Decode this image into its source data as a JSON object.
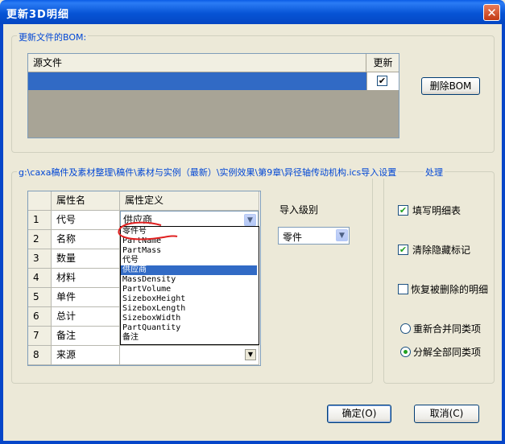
{
  "window": {
    "title": "更新3D明细",
    "close_glyph": "✕"
  },
  "bom_group": {
    "label": "更新文件的BOM:",
    "col_source": "源文件",
    "col_update": "更新",
    "row_checked": true,
    "delete_button": "删除BOM"
  },
  "settings_group": {
    "label": "g:\\caxa稿件及素材整理\\稿件\\素材与实例（最新）\\实例效果\\第9章\\异径轴传动机构.ics导入设置",
    "process_label_fragment": "处理",
    "col_attr_name": "属性名",
    "col_attr_def": "属性定义",
    "rows": [
      {
        "num": "1",
        "name": "代号",
        "definition": "供应商"
      },
      {
        "num": "2",
        "name": "名称",
        "definition": ""
      },
      {
        "num": "3",
        "name": "数量",
        "definition": ""
      },
      {
        "num": "4",
        "name": "材料",
        "definition": ""
      },
      {
        "num": "5",
        "name": "单件",
        "definition": ""
      },
      {
        "num": "6",
        "name": "总计",
        "definition": ""
      },
      {
        "num": "7",
        "name": "备注",
        "definition": ""
      },
      {
        "num": "8",
        "name": "来源",
        "definition": ""
      }
    ],
    "dropdown_options": [
      "零件号",
      "PartName",
      "PartMass",
      "代号",
      "供应商",
      "MassDensity",
      "PartVolume",
      "SizeboxHeight",
      "SizeboxLength",
      "SizeboxWidth",
      "PartQuantity",
      "备注"
    ],
    "dropdown_selected": "供应商",
    "import_level_label": "导入级别",
    "import_level_value": "零件"
  },
  "options": {
    "fill_detail": {
      "label": "填写明细表",
      "checked": true
    },
    "clear_hidden": {
      "label": "清除隐藏标记",
      "checked": true
    },
    "restore_deleted": {
      "label": "恢复被删除的明细",
      "checked": false
    },
    "merge_same": {
      "label": "重新合并同类项",
      "selected": false
    },
    "split_all": {
      "label": "分解全部同类项",
      "selected": true
    }
  },
  "buttons": {
    "ok": "确定(O)",
    "cancel": "取消(C)"
  },
  "colors": {
    "title_blue": "#0754d6",
    "selection_blue": "#316ac5",
    "group_label": "#0046d5",
    "annotation_red": "#e02020"
  }
}
